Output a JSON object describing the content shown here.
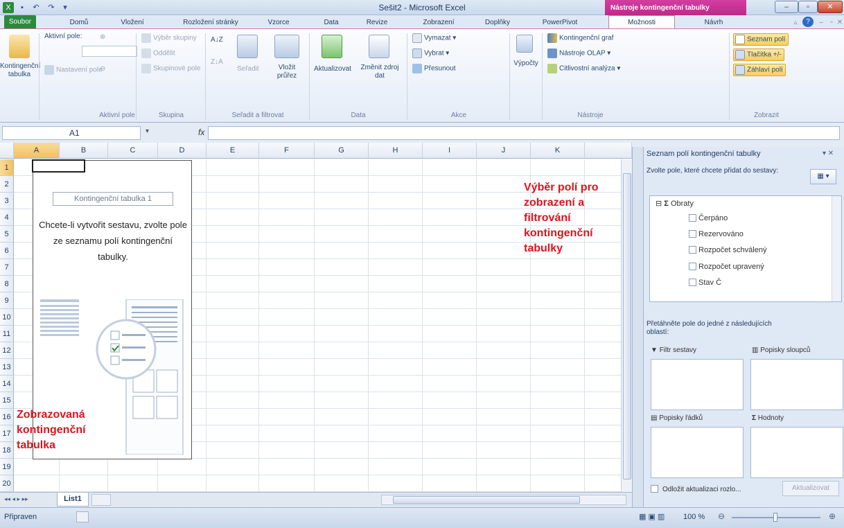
{
  "window": {
    "title": "Sešit2 - Microsoft Excel",
    "context_title": "Nástroje kontingenční tabulky"
  },
  "tabs": [
    "Soubor",
    "Domů",
    "Vložení",
    "Rozložení stránky",
    "Vzorce",
    "Data",
    "Revize",
    "Zobrazení",
    "Doplňky",
    "PowerPivot",
    "Možnosti",
    "Návrh"
  ],
  "ribbon": {
    "pivot_btn": "Kontingenční tabulka",
    "active_field_label": "Aktivní pole:",
    "field_settings": "Nastavení pole",
    "group_active_field": "Aktivní pole",
    "group_selection": "Výběr skupiny",
    "ungroup": "Oddělit",
    "group_field": "Skupinové pole",
    "group_group": "Skupina",
    "sort": "Seřadit",
    "insert_slicer": "Vložit průřez",
    "group_sort": "Seřadit a filtrovat",
    "refresh": "Aktualizovat",
    "change_source": "Změnit zdroj dat",
    "group_data": "Data",
    "clear": "Vymazat",
    "select": "Vybrat",
    "move": "Přesunout",
    "group_actions": "Akce",
    "calculations": "Výpočty",
    "pivot_chart": "Kontingenční graf",
    "olap_tools": "Nástroje OLAP",
    "whatif": "Citlivostní analýza",
    "group_tools": "Nástroje",
    "field_list": "Seznam polí",
    "buttons": "Tlačítka +/-",
    "headers": "Záhlaví polí",
    "group_show": "Zobrazit"
  },
  "formula": {
    "name_box": "A1",
    "fx": "fx"
  },
  "grid": {
    "columns": [
      "A",
      "B",
      "C",
      "D",
      "E",
      "F",
      "G",
      "H",
      "I",
      "J",
      "K"
    ],
    "rows": [
      "1",
      "2",
      "3",
      "4",
      "5",
      "6",
      "7",
      "8",
      "9",
      "10",
      "11",
      "12",
      "13",
      "14",
      "15",
      "16",
      "17",
      "18",
      "19",
      "20"
    ],
    "pivot_title": "Kontingenční tabulka 1",
    "pivot_text": "Chcete-li vytvořit sestavu, zvolte pole ze seznamu polí kontingenční tabulky."
  },
  "annotations": {
    "right": "Výběr polí pro zobrazení a filtrování kontingenční tabulky",
    "left": "Zobrazovaná kontingenční tabulka"
  },
  "sheet": {
    "tab": "List1"
  },
  "status": {
    "ready": "Připraven",
    "zoom": "100 %"
  },
  "pane": {
    "title": "Seznam polí kontingenční tabulky",
    "choose_text": "Zvolte pole, které chcete přidat do sestavy:",
    "group": "Obraty",
    "fields": [
      "Čerpáno",
      "Rezervováno",
      "Rozpočet schválený",
      "Rozpočet upravený",
      "Stav Č"
    ],
    "drag_text": "Přetáhněte pole do jedné z následujících oblastí:",
    "filter": "Filtr sestavy",
    "columns": "Popisky sloupců",
    "rows": "Popisky řádků",
    "values": "Hodnoty",
    "defer": "Odložit aktualizaci rozlo...",
    "update": "Aktualizovat"
  },
  "colors": {
    "file_tab": "#2b8a3e",
    "context": "#b11f7c",
    "annotation": "#d8151e"
  }
}
